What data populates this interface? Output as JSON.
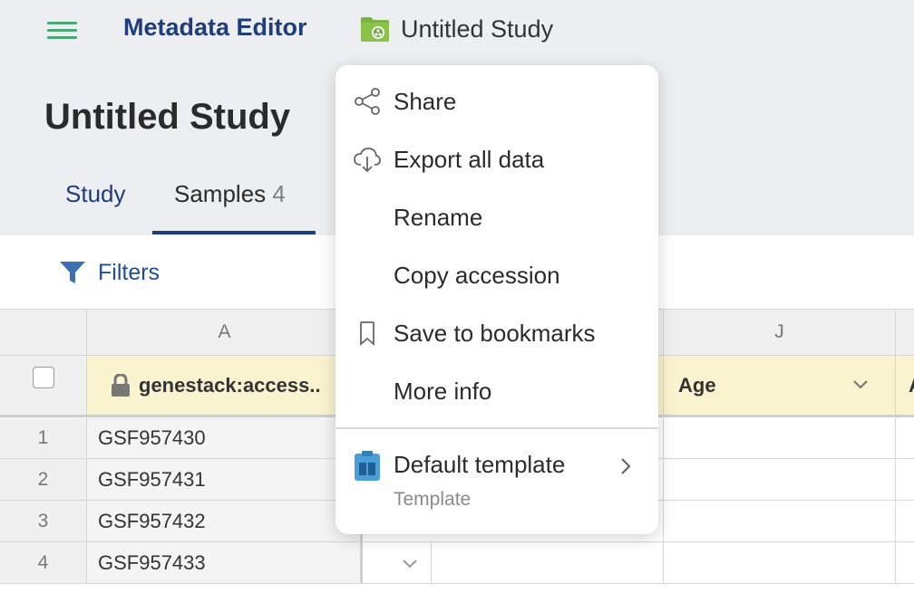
{
  "header": {
    "menu_icon": "hamburger-icon",
    "app_title": "Metadata Editor",
    "study_icon": "study-folder-icon",
    "study_name": "Untitled Study"
  },
  "page": {
    "title": "Untitled Study"
  },
  "tabs": [
    {
      "label": "Study",
      "count": ""
    },
    {
      "label": "Samples",
      "count": "4",
      "selected": true
    }
  ],
  "toolbar": {
    "filters_label": "Filters",
    "filters_icon": "filter-icon"
  },
  "table": {
    "columns": [
      {
        "letter": "A",
        "field": "genestack:access..",
        "locked": true
      },
      {
        "letter": "J",
        "field": "Age",
        "locked": false
      },
      {
        "letter": "",
        "field": "A"
      }
    ],
    "rows": [
      {
        "num": "1",
        "accession": "GSF957430"
      },
      {
        "num": "2",
        "accession": "GSF957431"
      },
      {
        "num": "3",
        "accession": "GSF957432"
      },
      {
        "num": "4",
        "accession": "GSF957433"
      }
    ]
  },
  "menu": {
    "items": [
      {
        "label": "Share",
        "icon": "share-icon"
      },
      {
        "label": "Export all data",
        "icon": "cloud-download-icon"
      },
      {
        "label": "Rename",
        "icon": ""
      },
      {
        "label": "Copy accession",
        "icon": ""
      },
      {
        "label": "Save to bookmarks",
        "icon": "bookmark-icon"
      },
      {
        "label": "More info",
        "icon": ""
      }
    ],
    "template": {
      "label": "Default template",
      "sublabel": "Template",
      "icon": "template-icon"
    }
  },
  "colors": {
    "accent_navy": "#1f3d7a",
    "green": "#4ba874",
    "header_bg": "#eceef1",
    "field_header_bg": "#faf3cf"
  }
}
